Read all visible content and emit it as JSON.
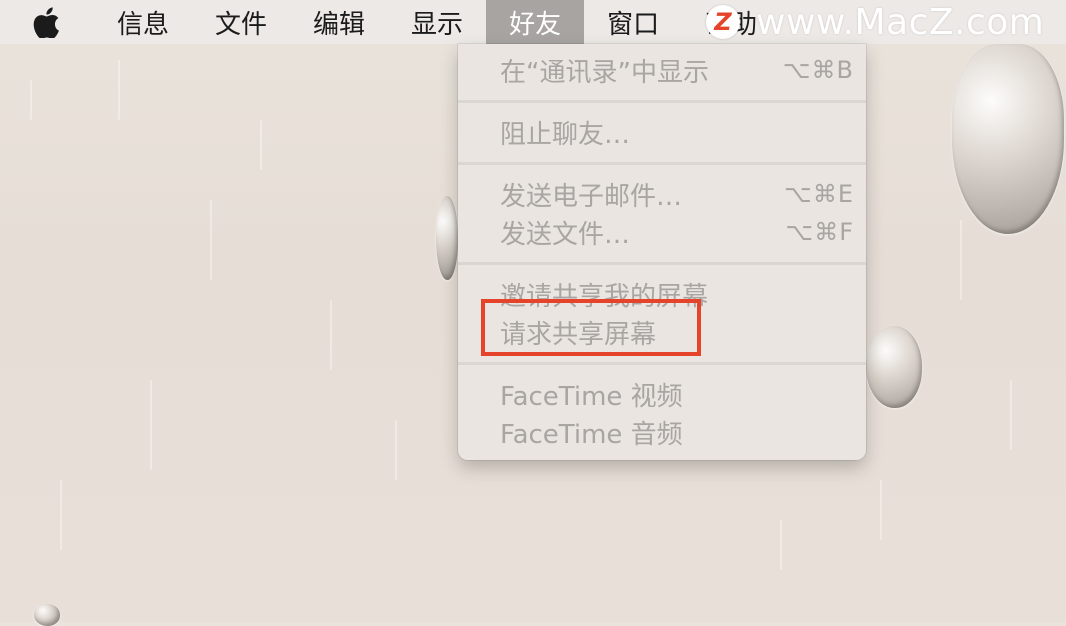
{
  "menubar": {
    "apple_icon": "apple-logo-icon",
    "items": [
      {
        "label": "信息"
      },
      {
        "label": "文件"
      },
      {
        "label": "编辑"
      },
      {
        "label": "显示"
      },
      {
        "label": "好友"
      },
      {
        "label": "窗口"
      },
      {
        "label": "帮助"
      }
    ],
    "active_index": 4
  },
  "watermark": {
    "logo_letter": "Z",
    "text": "www.MacZ.com"
  },
  "friends_menu": {
    "items": [
      {
        "label": "在“通讯录”中显示",
        "shortcut": "⌥⌘B",
        "enabled": false
      },
      {
        "label": "阻止聊友…",
        "shortcut": "",
        "enabled": false
      },
      {
        "label": "发送电子邮件…",
        "shortcut": "⌥⌘E",
        "enabled": false
      },
      {
        "label": "发送文件…",
        "shortcut": "⌥⌘F",
        "enabled": false
      },
      {
        "label": "邀请共享我的屏幕",
        "shortcut": "",
        "enabled": false
      },
      {
        "label": "请求共享屏幕",
        "shortcut": "",
        "enabled": false
      },
      {
        "label": "FaceTime 视频",
        "shortcut": "",
        "enabled": false
      },
      {
        "label": "FaceTime 音频",
        "shortcut": "",
        "enabled": false
      }
    ]
  },
  "colors": {
    "highlight_box": "#e5432a",
    "disabled_text": "#a8a5a2",
    "active_menu_bg": "#a7a4a1"
  }
}
